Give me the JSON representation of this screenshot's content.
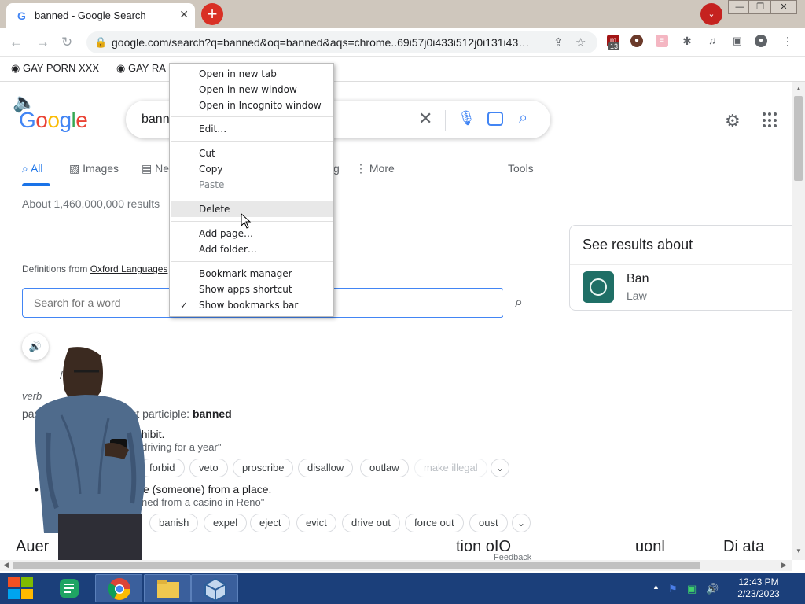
{
  "browser": {
    "tab_title": "banned - Google Search",
    "tab_close": "✕",
    "new_tab": "+",
    "tab_search": "⌄",
    "window_controls": {
      "minimize": "—",
      "restore": "❐",
      "close": "✕"
    },
    "nav": {
      "back": "←",
      "forward": "→",
      "reload": "↻"
    },
    "url": "google.com/search?q=banned&oq=banned&aqs=chrome..69i57j0i433i512j0i131i43…",
    "extension_badge": "13",
    "bookmarks": [
      "GAY PORN XXX",
      "GAY RA"
    ]
  },
  "google": {
    "logo_letters": [
      {
        "ch": "G",
        "color": "#4285f4"
      },
      {
        "ch": "o",
        "color": "#ea4335"
      },
      {
        "ch": "o",
        "color": "#fbbc05"
      },
      {
        "ch": "g",
        "color": "#4285f4"
      },
      {
        "ch": "l",
        "color": "#34a853"
      },
      {
        "ch": "e",
        "color": "#ea4335"
      }
    ],
    "query": "bann",
    "tabs": {
      "all": "All",
      "images": "Images",
      "news": "Ne",
      "partial": "g",
      "more": "More",
      "tools": "Tools"
    },
    "stats": "About 1,460,000,000 results"
  },
  "dictionary": {
    "source_prefix": "Definitions from",
    "source_link": "Oxford Languages",
    "search_placeholder": "Search for a word",
    "phonetic": "/b",
    "part_of_speech": "verb",
    "tense_prefix": "pas",
    "tense_mid": "ast participle:",
    "tense_word": "banned",
    "def1": "ohibit.",
    "def1_example": "driving for a year\"",
    "synonyms1": [
      "forbid",
      "veto",
      "proscribe",
      "disallow",
      "outlaw",
      "make illegal"
    ],
    "def2": "e (someone) from a place.",
    "def2_example": "ned from a casino in Reno\"",
    "synonyms2": [
      "banish",
      "expel",
      "eject",
      "evict",
      "drive out",
      "force out",
      "oust"
    ],
    "cutoff_left": "Auer",
    "cutoff_mid": "tion     oIO",
    "cutoff_right": "uonl",
    "cutoff_far": "Di ata",
    "feedback": "Feedback"
  },
  "knowledge_panel": {
    "title": "See results about",
    "name": "Ban",
    "subtitle": "Law"
  },
  "context_menu": {
    "items": {
      "open_new_tab": "Open in new tab",
      "open_new_window": "Open in new window",
      "open_incognito": "Open in Incognito window",
      "edit": "Edit…",
      "cut": "Cut",
      "copy": "Copy",
      "paste": "Paste",
      "delete": "Delete",
      "add_page": "Add page…",
      "add_folder": "Add folder…",
      "bookmark_manager": "Bookmark manager",
      "show_apps_shortcut": "Show apps shortcut",
      "show_bookmarks_bar": "Show bookmarks bar"
    },
    "checkmark": "✓",
    "checked_item": "show_bookmarks_bar",
    "hovered_item": "delete",
    "disabled_item": "paste"
  },
  "taskbar": {
    "time": "12:43 PM",
    "date": "2/23/2023"
  },
  "colors": {
    "accent": "#1a73e8",
    "taskbar": "#1b3f7a",
    "newtab_button": "#d93025"
  }
}
